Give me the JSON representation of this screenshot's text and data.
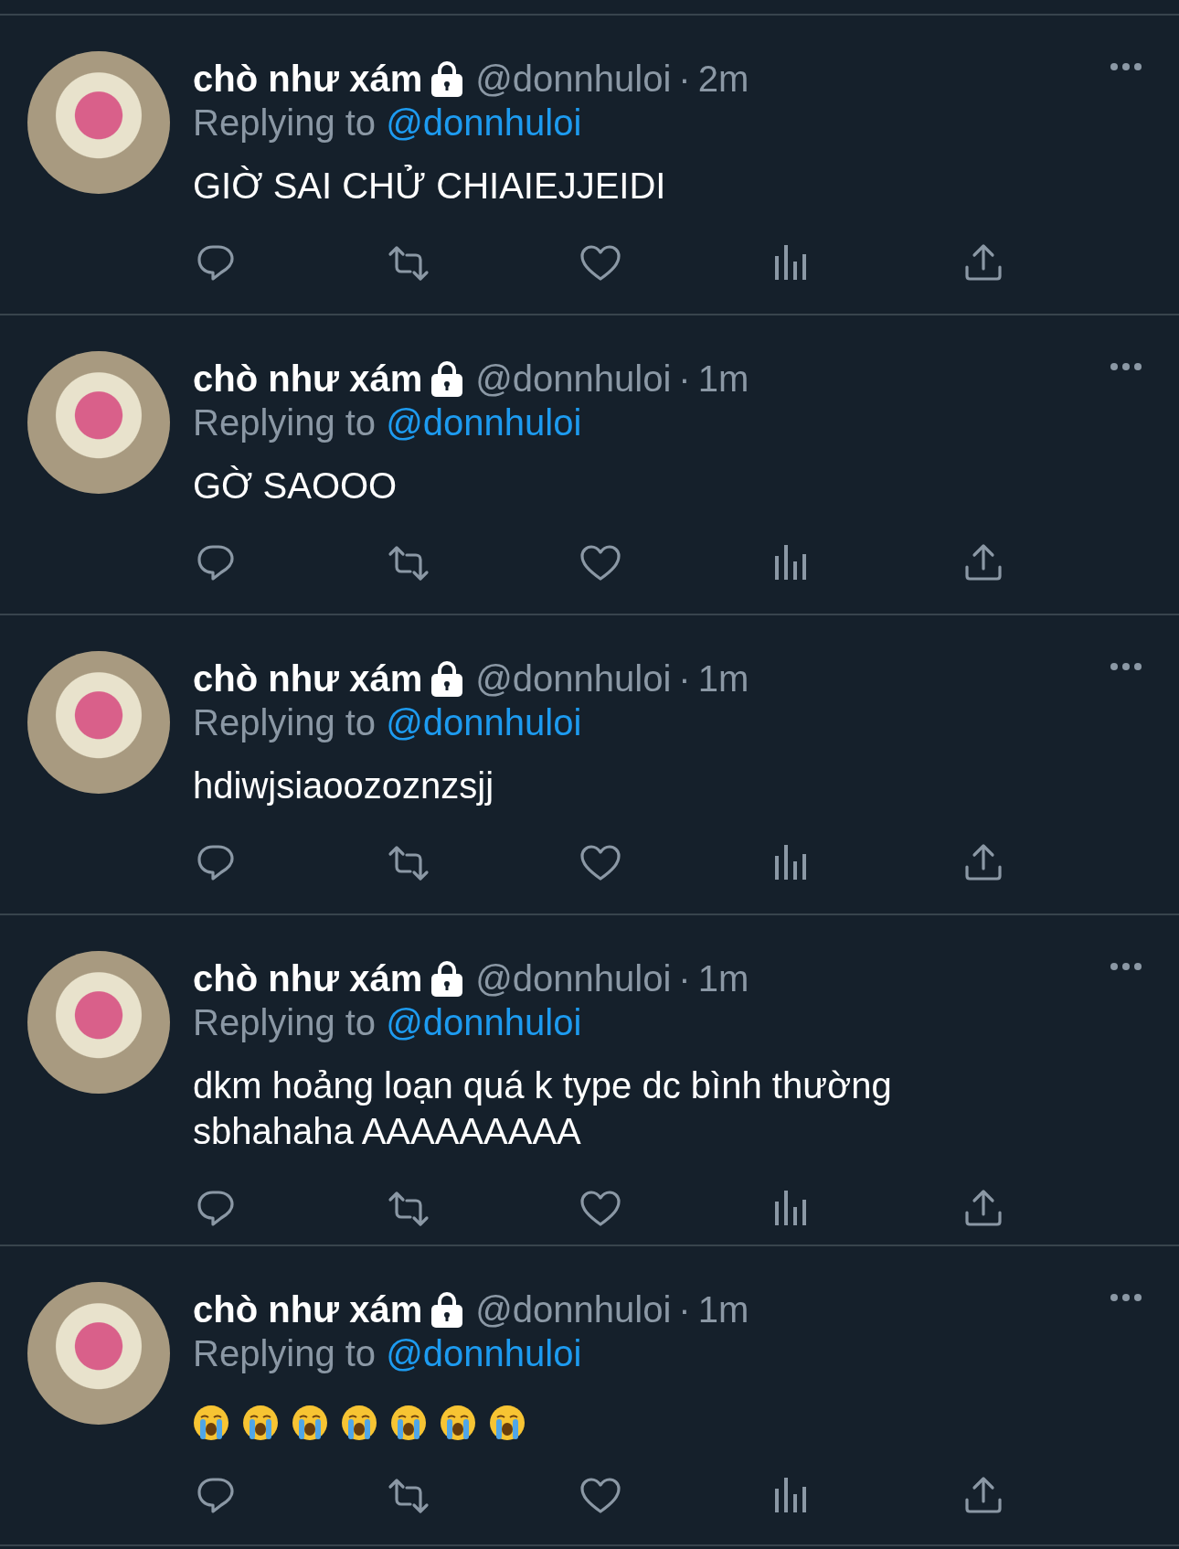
{
  "tweets": [
    {
      "name": "chò như xám",
      "protected": true,
      "handle": "@donnhuloi",
      "separator": "·",
      "time": "2m",
      "replying_label": "Replying to",
      "reply_to": "@donnhuloi",
      "text": "GIỜ SAI CHỬ CHIAIEJJEIDI"
    },
    {
      "name": "chò như xám",
      "protected": true,
      "handle": "@donnhuloi",
      "separator": "·",
      "time": "1m",
      "replying_label": "Replying to",
      "reply_to": "@donnhuloi",
      "text": "GỜ SAOOO"
    },
    {
      "name": "chò như xám",
      "protected": true,
      "handle": "@donnhuloi",
      "separator": "·",
      "time": "1m",
      "replying_label": "Replying to",
      "reply_to": "@donnhuloi",
      "text": "hdiwjsiaoozoznzsjj"
    },
    {
      "name": "chò như xám",
      "protected": true,
      "handle": "@donnhuloi",
      "separator": "·",
      "time": "1m",
      "replying_label": "Replying to",
      "reply_to": "@donnhuloi",
      "text": "dkm hoảng loạn quá k type dc bình thường sbhahaha AAAAAAAAA"
    },
    {
      "name": "chò như xám",
      "protected": true,
      "handle": "@donnhuloi",
      "separator": "·",
      "time": "1m",
      "replying_label": "Replying to",
      "reply_to": "@donnhuloi",
      "emojis": [
        {
          "kind": "crying"
        },
        {
          "kind": "crying"
        },
        {
          "kind": "crying"
        },
        {
          "kind": "crying"
        },
        {
          "kind": "crying"
        },
        {
          "kind": "crying"
        },
        {
          "kind": "crying"
        }
      ]
    }
  ]
}
